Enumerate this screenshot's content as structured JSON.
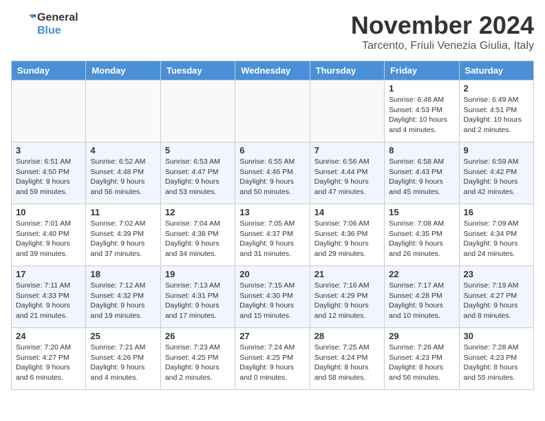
{
  "header": {
    "logo_line1": "General",
    "logo_line2": "Blue",
    "month_title": "November 2024",
    "location": "Tarcento, Friuli Venezia Giulia, Italy"
  },
  "days_of_week": [
    "Sunday",
    "Monday",
    "Tuesday",
    "Wednesday",
    "Thursday",
    "Friday",
    "Saturday"
  ],
  "weeks": [
    [
      {
        "day": "",
        "info": ""
      },
      {
        "day": "",
        "info": ""
      },
      {
        "day": "",
        "info": ""
      },
      {
        "day": "",
        "info": ""
      },
      {
        "day": "",
        "info": ""
      },
      {
        "day": "1",
        "info": "Sunrise: 6:48 AM\nSunset: 4:53 PM\nDaylight: 10 hours and 4 minutes."
      },
      {
        "day": "2",
        "info": "Sunrise: 6:49 AM\nSunset: 4:51 PM\nDaylight: 10 hours and 2 minutes."
      }
    ],
    [
      {
        "day": "3",
        "info": "Sunrise: 6:51 AM\nSunset: 4:50 PM\nDaylight: 9 hours and 59 minutes."
      },
      {
        "day": "4",
        "info": "Sunrise: 6:52 AM\nSunset: 4:48 PM\nDaylight: 9 hours and 56 minutes."
      },
      {
        "day": "5",
        "info": "Sunrise: 6:53 AM\nSunset: 4:47 PM\nDaylight: 9 hours and 53 minutes."
      },
      {
        "day": "6",
        "info": "Sunrise: 6:55 AM\nSunset: 4:46 PM\nDaylight: 9 hours and 50 minutes."
      },
      {
        "day": "7",
        "info": "Sunrise: 6:56 AM\nSunset: 4:44 PM\nDaylight: 9 hours and 47 minutes."
      },
      {
        "day": "8",
        "info": "Sunrise: 6:58 AM\nSunset: 4:43 PM\nDaylight: 9 hours and 45 minutes."
      },
      {
        "day": "9",
        "info": "Sunrise: 6:59 AM\nSunset: 4:42 PM\nDaylight: 9 hours and 42 minutes."
      }
    ],
    [
      {
        "day": "10",
        "info": "Sunrise: 7:01 AM\nSunset: 4:40 PM\nDaylight: 9 hours and 39 minutes."
      },
      {
        "day": "11",
        "info": "Sunrise: 7:02 AM\nSunset: 4:39 PM\nDaylight: 9 hours and 37 minutes."
      },
      {
        "day": "12",
        "info": "Sunrise: 7:04 AM\nSunset: 4:38 PM\nDaylight: 9 hours and 34 minutes."
      },
      {
        "day": "13",
        "info": "Sunrise: 7:05 AM\nSunset: 4:37 PM\nDaylight: 9 hours and 31 minutes."
      },
      {
        "day": "14",
        "info": "Sunrise: 7:06 AM\nSunset: 4:36 PM\nDaylight: 9 hours and 29 minutes."
      },
      {
        "day": "15",
        "info": "Sunrise: 7:08 AM\nSunset: 4:35 PM\nDaylight: 9 hours and 26 minutes."
      },
      {
        "day": "16",
        "info": "Sunrise: 7:09 AM\nSunset: 4:34 PM\nDaylight: 9 hours and 24 minutes."
      }
    ],
    [
      {
        "day": "17",
        "info": "Sunrise: 7:11 AM\nSunset: 4:33 PM\nDaylight: 9 hours and 21 minutes."
      },
      {
        "day": "18",
        "info": "Sunrise: 7:12 AM\nSunset: 4:32 PM\nDaylight: 9 hours and 19 minutes."
      },
      {
        "day": "19",
        "info": "Sunrise: 7:13 AM\nSunset: 4:31 PM\nDaylight: 9 hours and 17 minutes."
      },
      {
        "day": "20",
        "info": "Sunrise: 7:15 AM\nSunset: 4:30 PM\nDaylight: 9 hours and 15 minutes."
      },
      {
        "day": "21",
        "info": "Sunrise: 7:16 AM\nSunset: 4:29 PM\nDaylight: 9 hours and 12 minutes."
      },
      {
        "day": "22",
        "info": "Sunrise: 7:17 AM\nSunset: 4:28 PM\nDaylight: 9 hours and 10 minutes."
      },
      {
        "day": "23",
        "info": "Sunrise: 7:19 AM\nSunset: 4:27 PM\nDaylight: 9 hours and 8 minutes."
      }
    ],
    [
      {
        "day": "24",
        "info": "Sunrise: 7:20 AM\nSunset: 4:27 PM\nDaylight: 9 hours and 6 minutes."
      },
      {
        "day": "25",
        "info": "Sunrise: 7:21 AM\nSunset: 4:26 PM\nDaylight: 9 hours and 4 minutes."
      },
      {
        "day": "26",
        "info": "Sunrise: 7:23 AM\nSunset: 4:25 PM\nDaylight: 9 hours and 2 minutes."
      },
      {
        "day": "27",
        "info": "Sunrise: 7:24 AM\nSunset: 4:25 PM\nDaylight: 9 hours and 0 minutes."
      },
      {
        "day": "28",
        "info": "Sunrise: 7:25 AM\nSunset: 4:24 PM\nDaylight: 8 hours and 58 minutes."
      },
      {
        "day": "29",
        "info": "Sunrise: 7:26 AM\nSunset: 4:23 PM\nDaylight: 8 hours and 56 minutes."
      },
      {
        "day": "30",
        "info": "Sunrise: 7:28 AM\nSunset: 4:23 PM\nDaylight: 8 hours and 55 minutes."
      }
    ]
  ]
}
